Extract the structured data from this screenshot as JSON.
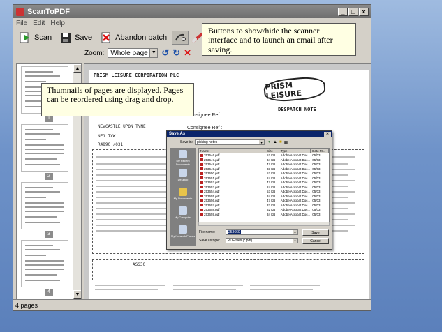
{
  "app": {
    "title": "ScanToPDF"
  },
  "menu": [
    "File",
    "Edit",
    "Help"
  ],
  "toolbar": {
    "scan": "Scan",
    "save": "Save",
    "abandon": "Abandon batch"
  },
  "zoom": {
    "label": "Zoom:",
    "value": "Whole page"
  },
  "thumbnails": [
    {
      "number": "1"
    },
    {
      "number": "2"
    },
    {
      "number": "3"
    },
    {
      "number": "4"
    }
  ],
  "status": {
    "text": "4 pages"
  },
  "callouts": {
    "toolbar": "Buttons to show/hide the scanner interface and to launch an email after saving.",
    "thumbnails": "Thumnails of pages are displayed. Pages can be reordered using drag and drop."
  },
  "document": {
    "company": "PRISM LEISURE CORPORATION PLC",
    "logo": "PRISM LEISURE",
    "despatch_title": "DESPATCH NOTE",
    "consignee": "Consignee Ref :",
    "town": "NEWCASTLE UPON TYNE",
    "postcode": "NE1 7XW",
    "account": "R4890 /031",
    "invoice": "ASS30"
  },
  "save_dialog": {
    "title": "Save As",
    "save_in_label": "Save in:",
    "save_in_value": "picking notes",
    "columns": [
      "Name",
      "Size",
      "Type",
      "Date M..."
    ],
    "files": [
      {
        "name": "253646.pdf",
        "size": "52 KB",
        "type": "Adobe Acrobat Doc...",
        "date": "05/03"
      },
      {
        "name": "253647.pdf",
        "size": "34 KB",
        "type": "Adobe Acrobat Doc...",
        "date": "05/03"
      },
      {
        "name": "253648.pdf",
        "size": "47 KB",
        "type": "Adobe Acrobat Doc...",
        "date": "05/03"
      },
      {
        "name": "253649.pdf",
        "size": "33 KB",
        "type": "Adobe Acrobat Doc...",
        "date": "05/03"
      },
      {
        "name": "253650.pdf",
        "size": "53 KB",
        "type": "Adobe Acrobat Doc...",
        "date": "05/03"
      },
      {
        "name": "253651.pdf",
        "size": "24 KB",
        "type": "Adobe Acrobat Doc...",
        "date": "05/03"
      },
      {
        "name": "253652.pdf",
        "size": "47 KB",
        "type": "Adobe Acrobat Doc...",
        "date": "05/03"
      },
      {
        "name": "253653.pdf",
        "size": "24 KB",
        "type": "Adobe Acrobat Doc...",
        "date": "05/03"
      },
      {
        "name": "253654.pdf",
        "size": "53 KB",
        "type": "Adobe Acrobat Doc...",
        "date": "05/03"
      },
      {
        "name": "253655.pdf",
        "size": "34 KB",
        "type": "Adobe Acrobat Doc...",
        "date": "05/03"
      },
      {
        "name": "253656.pdf",
        "size": "47 KB",
        "type": "Adobe Acrobat Doc...",
        "date": "05/03"
      },
      {
        "name": "253657.pdf",
        "size": "33 KB",
        "type": "Adobe Acrobat Doc...",
        "date": "05/03"
      },
      {
        "name": "253658.pdf",
        "size": "52 KB",
        "type": "Adobe Acrobat Doc...",
        "date": "05/03"
      },
      {
        "name": "253659.pdf",
        "size": "34 KB",
        "type": "Adobe Acrobat Doc...",
        "date": "05/03"
      }
    ],
    "places": [
      "My Recent Documents",
      "Desktop",
      "My Documents",
      "My Computer",
      "My Network Places"
    ],
    "filename_label": "File name:",
    "filename_value": "253660",
    "filetype_label": "Save as type:",
    "filetype_value": "PDF files (*.pdf)",
    "save_button": "Save",
    "cancel_button": "Cancel"
  },
  "colors": {
    "desktop": "#6f93c9",
    "window": "#d4d0c8",
    "callout": "#ffffe3",
    "dialog_title": "#0a246a"
  }
}
